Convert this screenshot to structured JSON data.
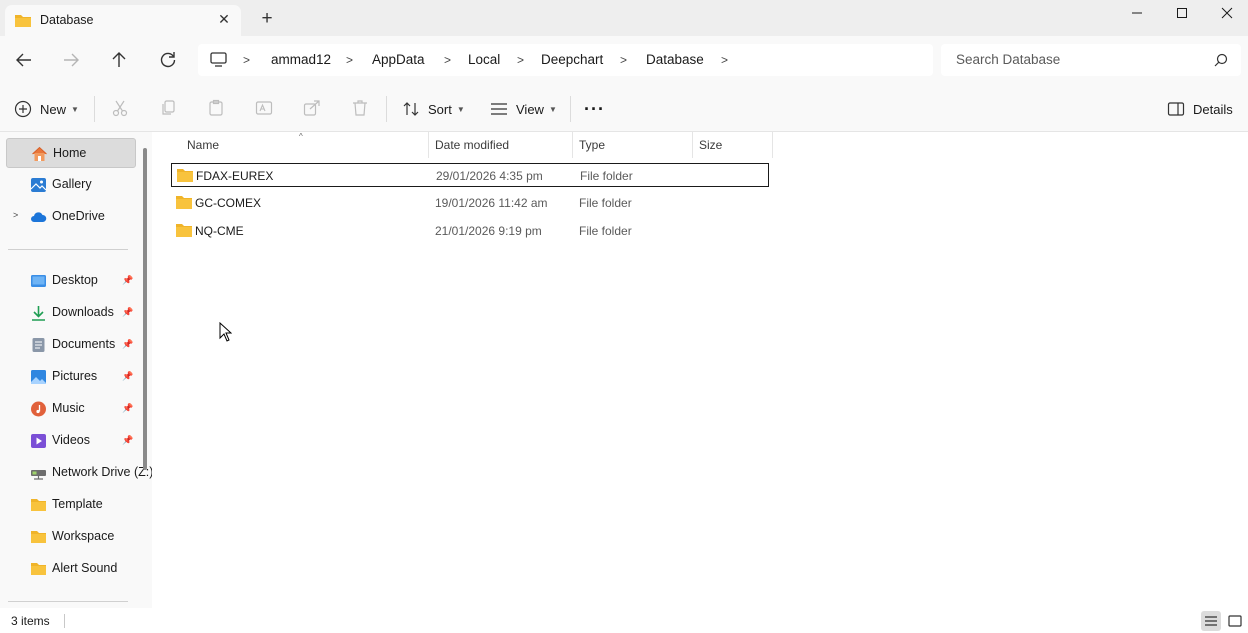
{
  "window": {
    "tab_title": "Database",
    "tab_close_icon": "close-icon",
    "new_tab_icon": "plus-icon",
    "minimize_icon": "minimize-icon",
    "maximize_icon": "maximize-icon",
    "close_icon": "close-icon"
  },
  "nav": {
    "back_icon": "arrow-left-icon",
    "forward_icon": "arrow-right-icon",
    "up_icon": "arrow-up-icon",
    "refresh_icon": "refresh-icon",
    "breadcrumb": [
      "ammad12",
      "AppData",
      "Local",
      "Deepchart",
      "Database"
    ],
    "search_placeholder": "Search Database"
  },
  "toolbar": {
    "new_label": "New",
    "sort_label": "Sort",
    "view_label": "View",
    "more_label": "···",
    "details_label": "Details"
  },
  "sidebar": {
    "items": [
      {
        "label": "Home",
        "icon": "home-icon",
        "selected": true
      },
      {
        "label": "Gallery",
        "icon": "gallery-icon"
      },
      {
        "label": "OneDrive",
        "icon": "cloud-icon",
        "expandable": true
      }
    ],
    "pinned": [
      {
        "label": "Desktop",
        "icon": "desktop-icon"
      },
      {
        "label": "Downloads",
        "icon": "download-icon"
      },
      {
        "label": "Documents",
        "icon": "document-icon"
      },
      {
        "label": "Pictures",
        "icon": "picture-icon"
      },
      {
        "label": "Music",
        "icon": "music-icon"
      },
      {
        "label": "Videos",
        "icon": "video-icon"
      },
      {
        "label": "Network Drive (Z:)",
        "icon": "network-drive-icon"
      }
    ],
    "folders": [
      {
        "label": "Template",
        "icon": "folder-icon"
      },
      {
        "label": "Workspace",
        "icon": "folder-icon"
      },
      {
        "label": "Alert Sound",
        "icon": "folder-icon"
      }
    ]
  },
  "columns": [
    "Name",
    "Date modified",
    "Type",
    "Size"
  ],
  "files": [
    {
      "name": "FDAX-EUREX",
      "date": "29/01/2026 4:35 pm",
      "type": "File folder",
      "size": ""
    },
    {
      "name": "GC-COMEX",
      "date": "19/01/2026 11:42 am",
      "type": "File folder",
      "size": ""
    },
    {
      "name": "NQ-CME",
      "date": "21/01/2026 9:19 pm",
      "type": "File folder",
      "size": ""
    }
  ],
  "status": {
    "item_count": "3 items"
  },
  "colors": {
    "folder": "#f8c33d",
    "selection": "#dcdcdc",
    "accent": "#0067c0"
  }
}
